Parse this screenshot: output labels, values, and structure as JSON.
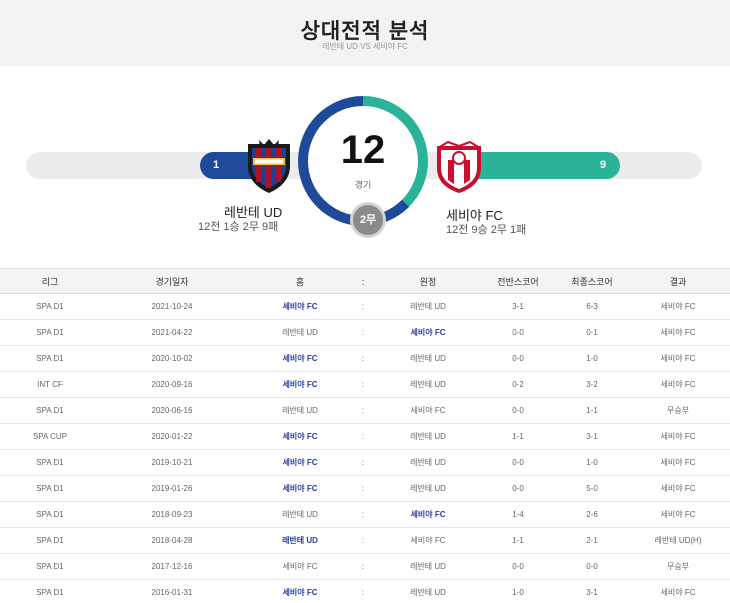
{
  "header": {
    "title": "상대전적 분석",
    "subtitle": "레반테 UD VS 세비야 FC"
  },
  "summary": {
    "total_matches": "12",
    "matches_unit": "경기",
    "draws_label": "2무",
    "home": {
      "name": "레반테 UD",
      "record": "12전 1승 2무 9패",
      "wins": "1",
      "color": "#1f4a99",
      "crest_icon": "levante-crest"
    },
    "away": {
      "name": "세비야 FC",
      "record": "12전 9승 2무 1패",
      "wins": "9",
      "color": "#2bb39a",
      "crest_icon": "sevilla-crest"
    }
  },
  "table": {
    "columns": {
      "league": "리그",
      "date": "경기일자",
      "home": "홈",
      "sep": ":",
      "away": "원정",
      "half": "전반스코어",
      "final": "최종스코어",
      "result": "결과"
    },
    "rows": [
      {
        "league": "SPA D1",
        "date": "2021-10-24",
        "home": "세비야 FC",
        "sep": ":",
        "away": "레반테 UD",
        "half": "3-1",
        "final": "6-3",
        "result": "세비야 FC",
        "winner": "home"
      },
      {
        "league": "SPA D1",
        "date": "2021-04-22",
        "home": "레반테 UD",
        "sep": ":",
        "away": "세비야 FC",
        "half": "0-0",
        "final": "0-1",
        "result": "세비야 FC",
        "winner": "away"
      },
      {
        "league": "SPA D1",
        "date": "2020-10-02",
        "home": "세비야 FC",
        "sep": ":",
        "away": "레반테 UD",
        "half": "0-0",
        "final": "1-0",
        "result": "세비야 FC",
        "winner": "home"
      },
      {
        "league": "INT CF",
        "date": "2020-09-16",
        "home": "세비야 FC",
        "sep": ":",
        "away": "레반테 UD",
        "half": "0-2",
        "final": "3-2",
        "result": "세비야 FC",
        "winner": "home"
      },
      {
        "league": "SPA D1",
        "date": "2020-06-16",
        "home": "레반테 UD",
        "sep": ":",
        "away": "세비야 FC",
        "half": "0-0",
        "final": "1-1",
        "result": "무승부",
        "winner": "none"
      },
      {
        "league": "SPA CUP",
        "date": "2020-01-22",
        "home": "세비야 FC",
        "sep": ":",
        "away": "레반테 UD",
        "half": "1-1",
        "final": "3-1",
        "result": "세비야 FC",
        "winner": "home"
      },
      {
        "league": "SPA D1",
        "date": "2019-10-21",
        "home": "세비야 FC",
        "sep": ":",
        "away": "레반테 UD",
        "half": "0-0",
        "final": "1-0",
        "result": "세비야 FC",
        "winner": "home"
      },
      {
        "league": "SPA D1",
        "date": "2019-01-26",
        "home": "세비야 FC",
        "sep": ":",
        "away": "레반테 UD",
        "half": "0-0",
        "final": "5-0",
        "result": "세비야 FC",
        "winner": "home"
      },
      {
        "league": "SPA D1",
        "date": "2018-09-23",
        "home": "레반테 UD",
        "sep": ":",
        "away": "세비야 FC",
        "half": "1-4",
        "final": "2-6",
        "result": "세비야 FC",
        "winner": "away"
      },
      {
        "league": "SPA D1",
        "date": "2018-04-28",
        "home": "레반테 UD",
        "sep": ":",
        "away": "세비야 FC",
        "half": "1-1",
        "final": "2-1",
        "result": "레반테 UD(H)",
        "winner": "home"
      },
      {
        "league": "SPA D1",
        "date": "2017-12-16",
        "home": "세비야 FC",
        "sep": ":",
        "away": "레반테 UD",
        "half": "0-0",
        "final": "0-0",
        "result": "무승부",
        "winner": "none"
      },
      {
        "league": "SPA D1",
        "date": "2016-01-31",
        "home": "세비야 FC",
        "sep": ":",
        "away": "레반테 UD",
        "half": "1-0",
        "final": "3-1",
        "result": "세비야 FC",
        "winner": "home"
      }
    ]
  }
}
